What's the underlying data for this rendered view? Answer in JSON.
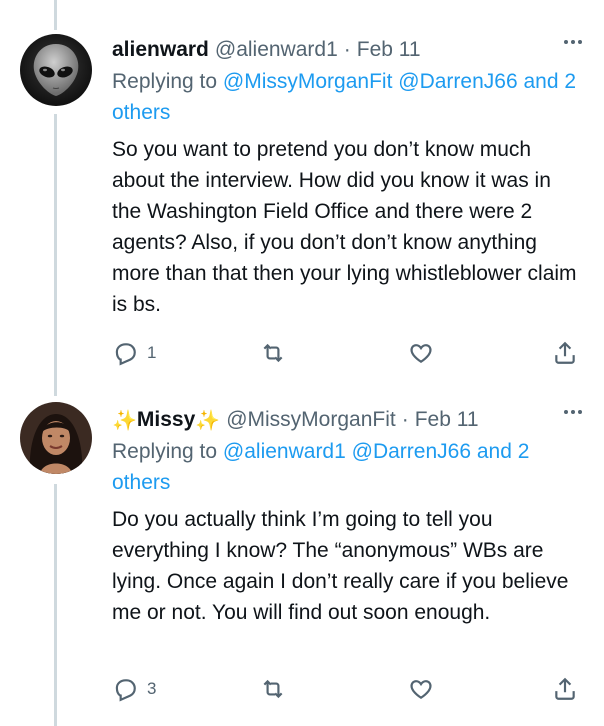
{
  "tweets": [
    {
      "name": "alienward",
      "handle": "@alienward1",
      "separator": "·",
      "date": "Feb 11",
      "reply_prefix": "Replying to",
      "reply_to": [
        "@MissyMorganFit",
        "@DarrenJ66"
      ],
      "reply_others": "and 2 others",
      "text": "So you want to pretend you don’t know much about the interview. How did you know it was in the Washington Field Office and there were 2 agents? Also, if you don’t don’t know anything more than that then your lying whistleblower claim is bs.",
      "reply_count": "1",
      "avatar_icon": "alien-avatar"
    },
    {
      "name_prefix": "✨",
      "name": "Missy",
      "name_suffix": "✨",
      "handle": "@MissyMorganFit",
      "separator": "·",
      "date": "Feb 11",
      "reply_prefix": "Replying to",
      "reply_to": [
        "@alienward1",
        "@DarrenJ66"
      ],
      "reply_others": "and 2 others",
      "text": "Do you actually think I’m going to tell you everything I know? The “anonymous” WBs are lying. Once again I don’t really care if you believe me or not. You will find out soon enough.",
      "reply_count": "3",
      "avatar_icon": "woman-avatar"
    }
  ],
  "icons": {
    "reply": "reply-icon",
    "retweet": "retweet-icon",
    "like": "heart-icon",
    "share": "share-icon",
    "more": "more-icon"
  },
  "colors": {
    "link": "#1d9bf0",
    "secondary": "#536471",
    "text": "#0f1419",
    "thread_line": "#cfd9de"
  }
}
